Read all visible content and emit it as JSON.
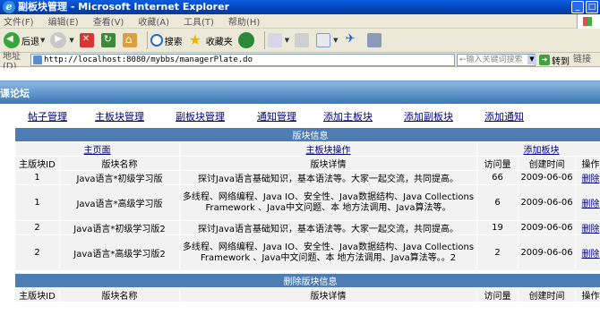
{
  "window": {
    "title": "副板块管理 - Microsoft Internet Explorer"
  },
  "menu": [
    "文件(F)",
    "编辑(E)",
    "查看(V)",
    "收藏(A)",
    "工具(T)",
    "帮助(H)"
  ],
  "toolbar": {
    "back": "后退",
    "search": "搜索",
    "favorites": "收藏夹"
  },
  "address": {
    "label": "地址(D)",
    "url": "http://localhost:8080/mybbs/managerPlate.do",
    "keyword_placeholder": "←输入关键词搜索",
    "go": "转到",
    "links": "链接"
  },
  "page": {
    "banner": "课论坛",
    "nav": [
      "帖子管理",
      "主板块管理",
      "副板块管理",
      "通知管理",
      "添加主板块",
      "添加副板块",
      "添加通知"
    ],
    "table": {
      "section_title": "版块信息",
      "links": [
        "主页面",
        "主板块操作",
        "添加板块"
      ],
      "headers": [
        "主版块ID",
        "版块名称",
        "版块详情",
        "访问量",
        "创建时间",
        "操作"
      ],
      "rows": [
        {
          "id": "1",
          "name": "Java语言*初级学习版",
          "detail": "探讨Java语言基础知识，基本语法等。大家一起交流，共同提高。",
          "visits": "66",
          "created": "2009-06-06",
          "action": "删除"
        },
        {
          "id": "1",
          "name": "Java语言*高级学习版",
          "detail": "多线程、网络编程、Java IO、安全性、Java数据结构、Java Collections Framework 、Java中文问题、本 地方法调用、Java算法等。",
          "visits": "6",
          "created": "2009-06-06",
          "action": "删除"
        },
        {
          "id": "2",
          "name": "Java语言*初级学习版2",
          "detail": "探讨Java语言基础知识，基本语法等。大家一起交流，共同提高。",
          "visits": "19",
          "created": "2009-06-06",
          "action": "删除"
        },
        {
          "id": "2",
          "name": "Java语言*高级学习版2",
          "detail": "多线程、网络编程、Java IO、安全性、Java数据结构、Java Collections Framework 、Java中文问题、本 地方法调用、Java算法等。。2",
          "visits": "2",
          "created": "2009-06-06",
          "action": "删除"
        }
      ],
      "deleted_title": "删除版块信息",
      "deleted_headers": [
        "主版块ID",
        "版块名称",
        "版块详情",
        "访问量",
        "创建时间",
        "操作"
      ]
    }
  }
}
